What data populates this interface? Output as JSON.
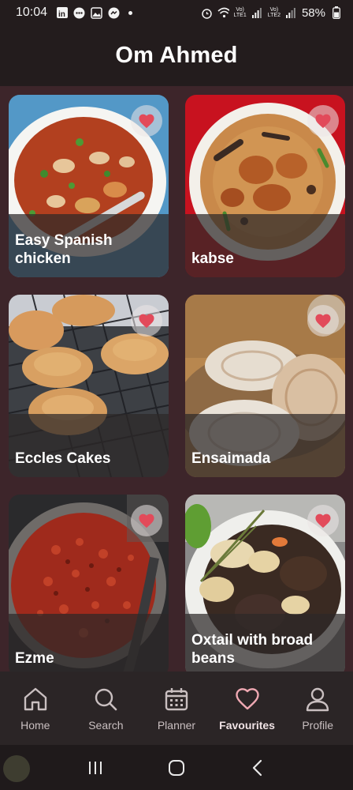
{
  "status_bar": {
    "time": "10:04",
    "battery": "58%",
    "sim1": "LTE1",
    "sim2": "LTE2",
    "volte": "Vo)"
  },
  "header": {
    "title": "Om Ahmed"
  },
  "recipes": [
    {
      "title": "Easy Spanish chicken",
      "favourite": true
    },
    {
      "title": "kabse",
      "favourite": true
    },
    {
      "title": "Eccles Cakes",
      "favourite": true
    },
    {
      "title": "Ensaimada",
      "favourite": true
    },
    {
      "title": "Ezme",
      "favourite": true
    },
    {
      "title": "Oxtail with broad beans",
      "favourite": true
    }
  ],
  "nav": {
    "active": "Favourites",
    "items": [
      {
        "label": "Home",
        "icon": "home-icon"
      },
      {
        "label": "Search",
        "icon": "search-icon"
      },
      {
        "label": "Planner",
        "icon": "calendar-icon"
      },
      {
        "label": "Favourites",
        "icon": "heart-icon"
      },
      {
        "label": "Profile",
        "icon": "person-icon"
      }
    ]
  },
  "colors": {
    "accent": "#e24a5a",
    "background": "#3d252a",
    "header": "#231c1d",
    "nav_active": "#f0a9b3"
  }
}
